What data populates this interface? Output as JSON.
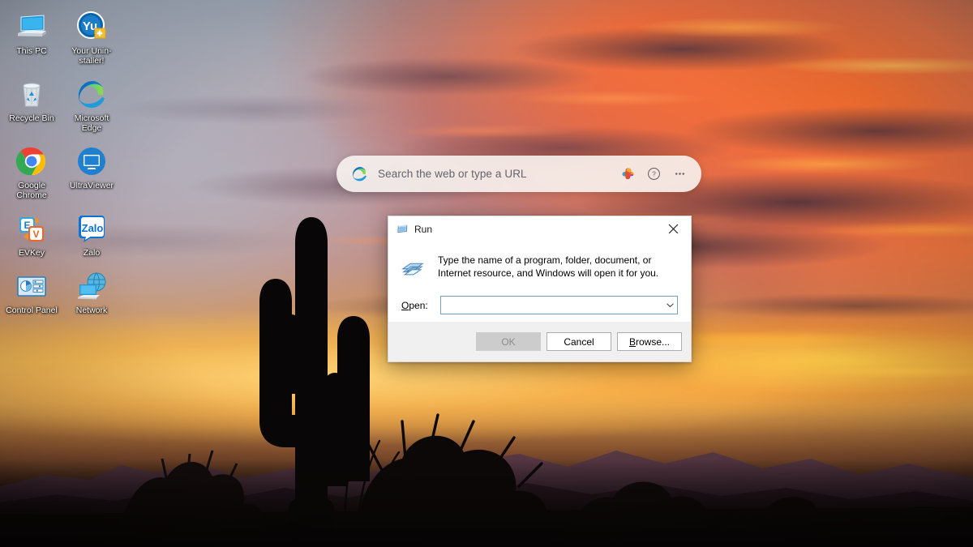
{
  "desktop": {
    "wallpaper_description": "Desert sunset with saguaro cactus silhouette and fiery orange clouds",
    "colors": {
      "sky_warm": "#ff6e28",
      "sky_cool": "#a8b4c4",
      "horizon_gold": "#ffd678",
      "ground_dark": "#0d0808"
    },
    "icons": [
      {
        "label": "This PC",
        "icon": "monitor-icon"
      },
      {
        "label": "Your Unin-staller!",
        "icon": "your-uninstaller-icon"
      },
      {
        "label": "Recycle Bin",
        "icon": "recycle-bin-icon"
      },
      {
        "label": "Microsoft Edge",
        "icon": "microsoft-edge-icon"
      },
      {
        "label": "Google Chrome",
        "icon": "google-chrome-icon"
      },
      {
        "label": "UltraViewer",
        "icon": "ultraviewer-icon"
      },
      {
        "label": "EVKey",
        "icon": "evkey-icon"
      },
      {
        "label": "Zalo",
        "icon": "zalo-icon"
      },
      {
        "label": "Control Panel",
        "icon": "control-panel-icon"
      },
      {
        "label": "Network",
        "icon": "network-icon"
      }
    ]
  },
  "search_widget": {
    "placeholder": "Search the web or type a URL",
    "left_icon": "microsoft-edge-icon",
    "copilot_icon": "copilot-icon",
    "help_icon": "help-circle-icon",
    "more_icon": "more-options-icon"
  },
  "run_dialog": {
    "title": "Run",
    "title_icon": "run-window-icon",
    "close_label": "✕",
    "body_icon": "run-app-icon",
    "description": "Type the name of a program, folder, document, or Internet resource, and Windows will open it for you.",
    "open_label_prefix": "O",
    "open_label_rest": "pen:",
    "open_value": "",
    "dropdown_icon": "chevron-down-icon",
    "buttons": {
      "ok": "OK",
      "ok_enabled": false,
      "cancel": "Cancel",
      "browse_prefix": "B",
      "browse_rest": "rowse..."
    }
  }
}
